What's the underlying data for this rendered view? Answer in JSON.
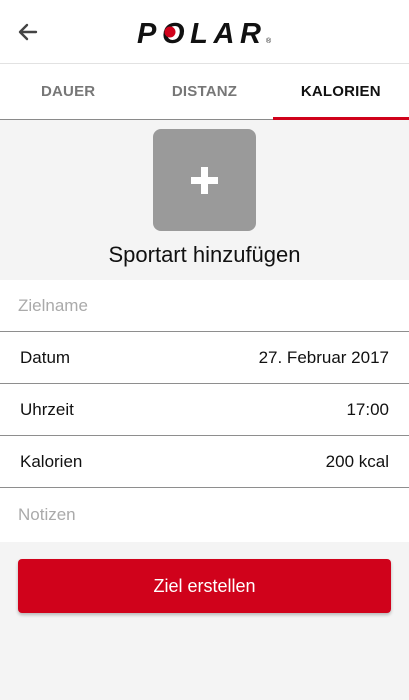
{
  "header": {
    "logo_text": "POLAR"
  },
  "tabs": [
    {
      "label": "DAUER",
      "active": false
    },
    {
      "label": "DISTANZ",
      "active": false
    },
    {
      "label": "KALORIEN",
      "active": true
    }
  ],
  "sport": {
    "add_label": "Sportart hinzufügen"
  },
  "form": {
    "goal_name_placeholder": "Zielname",
    "date_label": "Datum",
    "date_value": "27. Februar 2017",
    "time_label": "Uhrzeit",
    "time_value": "17:00",
    "calories_label": "Kalorien",
    "calories_value": "200 kcal",
    "notes_placeholder": "Notizen"
  },
  "actions": {
    "create_label": "Ziel erstellen"
  },
  "colors": {
    "accent": "#d0021b",
    "tile": "#9a9a9a",
    "background": "#f4f4f4"
  }
}
